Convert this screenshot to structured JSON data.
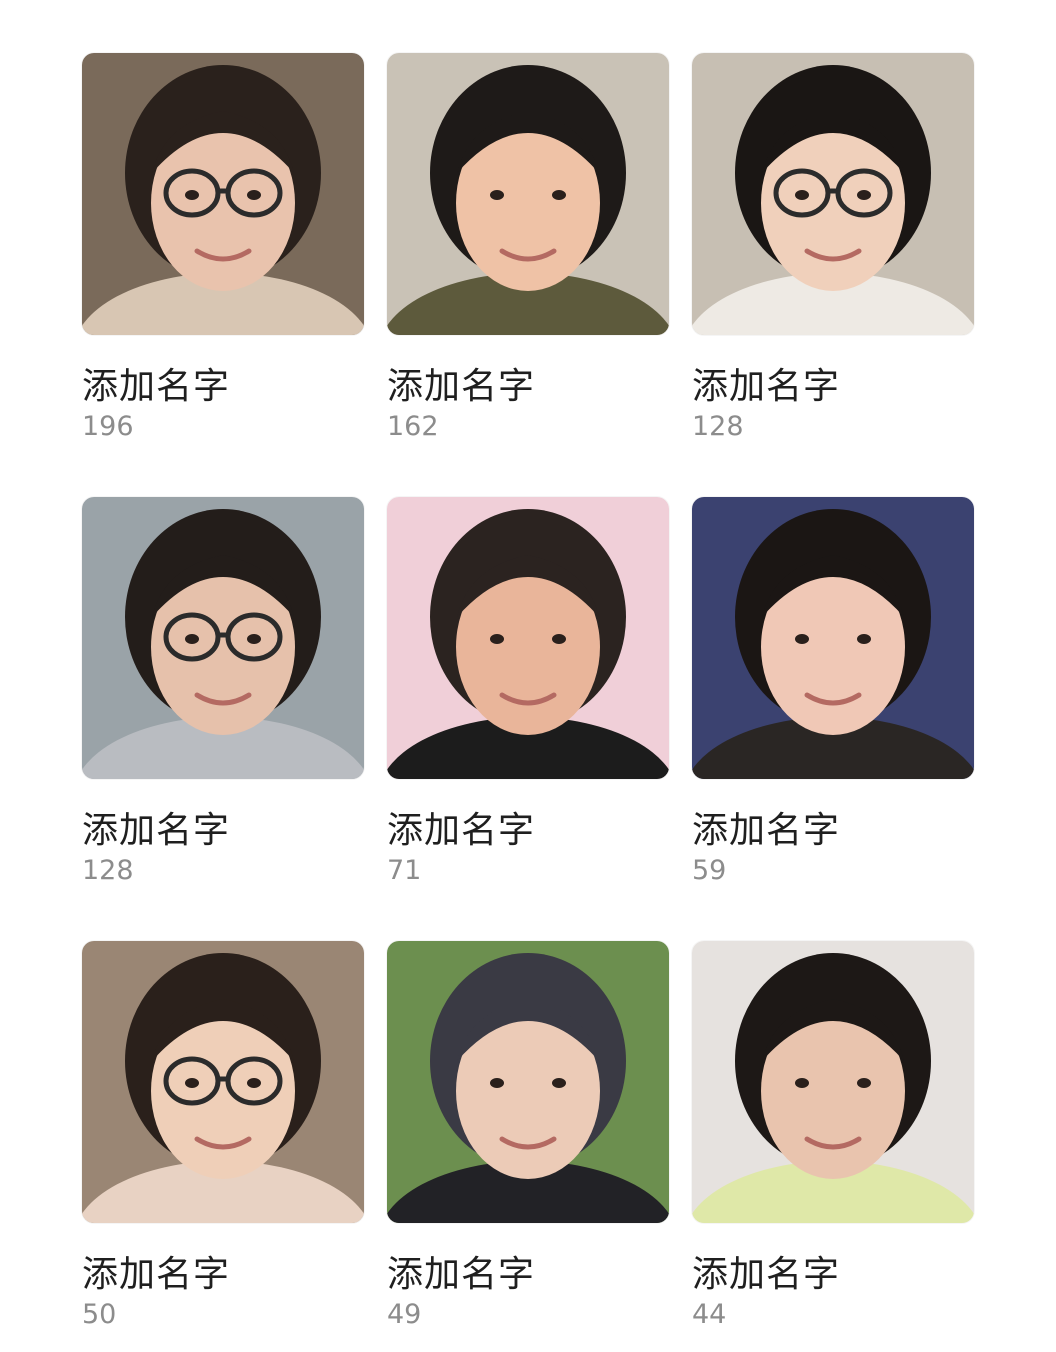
{
  "people": [
    {
      "name": "添加名字",
      "count": "196",
      "bg": "#7a6a5a",
      "hair": "#2a211c",
      "skin": "#e9c3ad",
      "top": "#d8c6b3",
      "glasses": true
    },
    {
      "name": "添加名字",
      "count": "162",
      "bg": "#c9c2b6",
      "hair": "#1e1a18",
      "skin": "#efc2a6",
      "top": "#5d5a3c",
      "glasses": false
    },
    {
      "name": "添加名字",
      "count": "128",
      "bg": "#c7bfb3",
      "hair": "#1a1614",
      "skin": "#f0d0bb",
      "top": "#eeeae4",
      "glasses": true
    },
    {
      "name": "添加名字",
      "count": "128",
      "bg": "#9aa3a8",
      "hair": "#231d1a",
      "skin": "#e6c1ab",
      "top": "#b9bcc1",
      "glasses": true
    },
    {
      "name": "添加名字",
      "count": "71",
      "bg": "#f0cfd8",
      "hair": "#2b2320",
      "skin": "#e9b59a",
      "top": "#1c1c1c",
      "glasses": false
    },
    {
      "name": "添加名字",
      "count": "59",
      "bg": "#3b4270",
      "hair": "#1b1614",
      "skin": "#f0c8b6",
      "top": "#2a2624",
      "glasses": false
    },
    {
      "name": "添加名字",
      "count": "50",
      "bg": "#9a8674",
      "hair": "#2a201b",
      "skin": "#efcfb8",
      "top": "#e8d2c3",
      "glasses": true
    },
    {
      "name": "添加名字",
      "count": "49",
      "bg": "#6c8f4f",
      "hair": "#3a3a44",
      "skin": "#eccbb7",
      "top": "#222226",
      "glasses": false
    },
    {
      "name": "添加名字",
      "count": "44",
      "bg": "#e6e2df",
      "hair": "#1d1816",
      "skin": "#e9c4ae",
      "top": "#dfe8a8",
      "glasses": false
    }
  ]
}
